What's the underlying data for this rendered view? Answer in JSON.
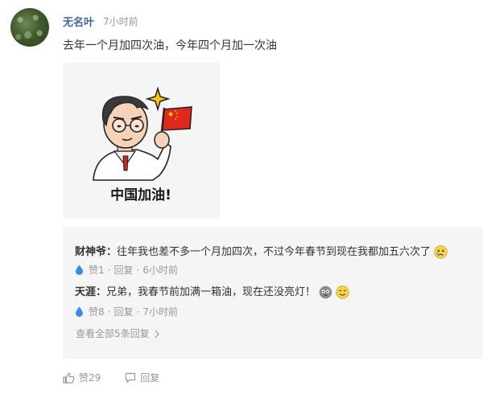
{
  "post": {
    "username": "无名叶",
    "time": "7小时前",
    "text": "去年一个月加四次油，今年四个月加一次油",
    "image_caption": "中国加油!"
  },
  "replies": [
    {
      "name": "财神爷",
      "colon": "：",
      "text": "往年我也差不多一个月加四次，不过今年春节到现在我都加五六次了",
      "likes": "赞1",
      "reply_label": "回复",
      "dot": "·",
      "time": "6小时前"
    },
    {
      "name": "天涯",
      "colon": "：",
      "text": "兄弟，我春节前加满一箱油，现在还没亮灯！",
      "likes": "赞8",
      "reply_label": "回复",
      "dot": "·",
      "time": "7小时前"
    }
  ],
  "see_all": "查看全部5条回复",
  "footer": {
    "like_count": "赞29",
    "reply_label": "回复"
  },
  "colors": {
    "username": "#406599",
    "muted": "#999999",
    "reply_bg": "#f5f5f5",
    "drop_blue": "#3d8be8",
    "flag_red": "#e0281e",
    "star_yellow": "#f5c518"
  }
}
